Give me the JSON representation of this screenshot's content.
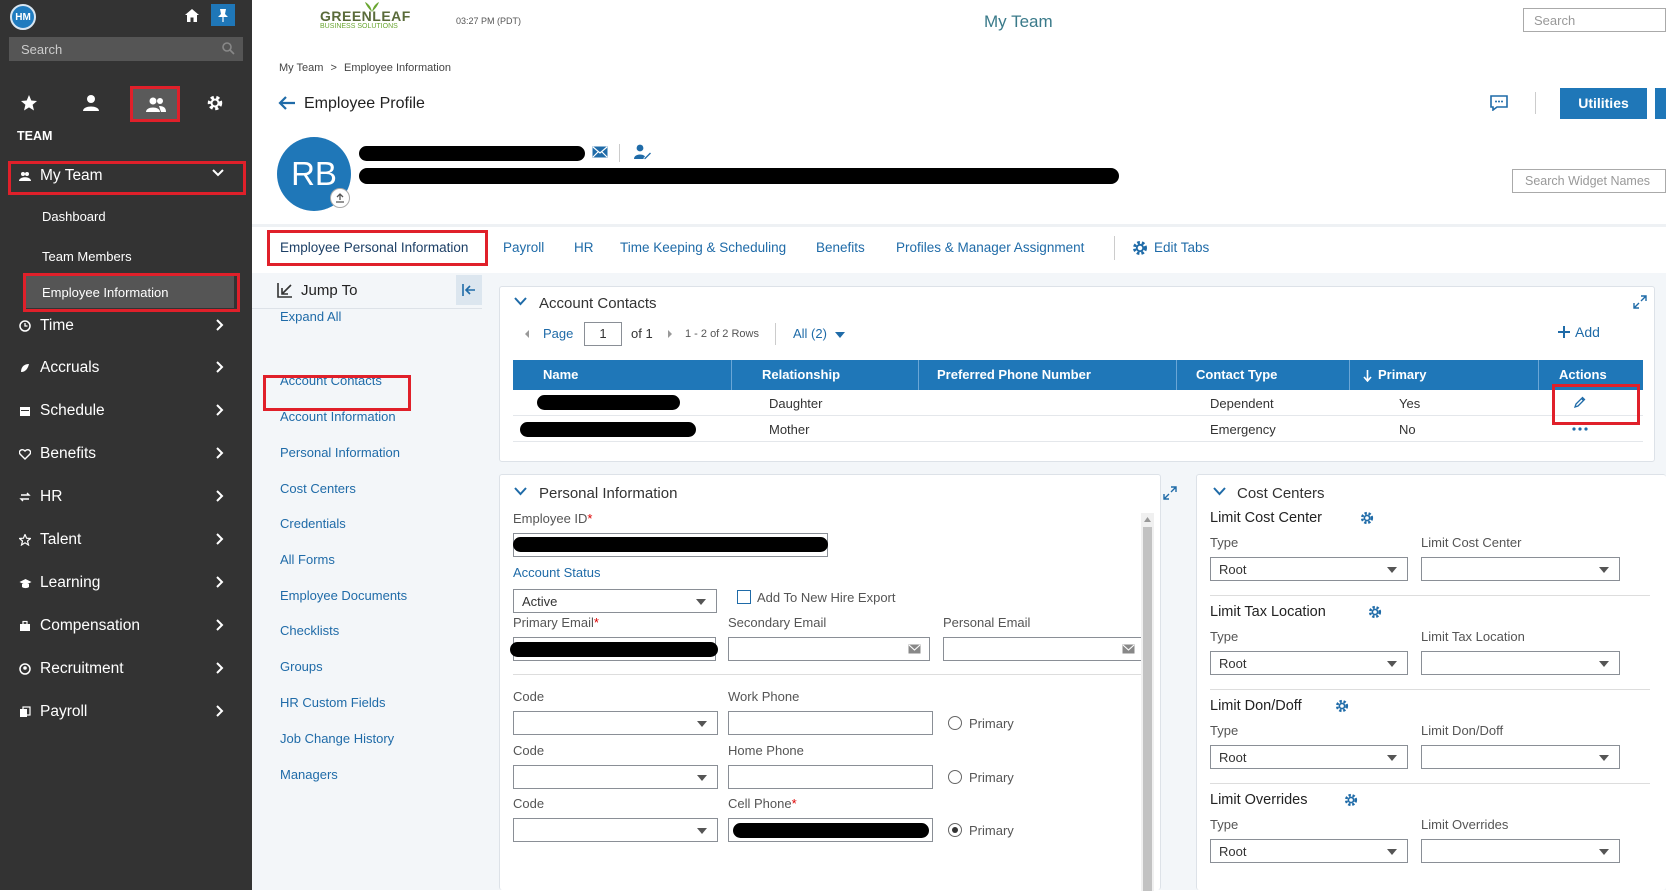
{
  "sidebar": {
    "avatar_initials": "HM",
    "search_placeholder": "Search",
    "section_title": "TEAM",
    "my_team_label": "My Team",
    "sub_items": [
      "Dashboard",
      "Team Members",
      "Employee Information"
    ],
    "nav_items": [
      "Time",
      "Accruals",
      "Schedule",
      "Benefits",
      "HR",
      "Talent",
      "Learning",
      "Compensation",
      "Recruitment",
      "Payroll"
    ]
  },
  "header": {
    "logo_top": "GREENLEAF",
    "logo_bottom": "BUSINESS SOLUTIONS",
    "time": "03:27 PM (PDT)",
    "page_title": "My Team",
    "search_placeholder": "Search"
  },
  "breadcrumb": {
    "root": "My Team",
    "sep": ">",
    "current": "Employee Information"
  },
  "profile": {
    "title": "Employee Profile",
    "initials": "RB",
    "utilities_label": "Utilities",
    "widget_search_placeholder": "Search Widget Names"
  },
  "tabs": [
    "Employee Personal Information",
    "Payroll",
    "HR",
    "Time Keeping & Scheduling",
    "Benefits",
    "Profiles & Manager Assignment"
  ],
  "edit_tabs_label": "Edit Tabs",
  "jump": {
    "title": "Jump To",
    "expand_all": "Expand All",
    "items": [
      "Account Contacts",
      "Account Information",
      "Personal Information",
      "Cost Centers",
      "Credentials",
      "All Forms",
      "Employee Documents",
      "Checklists",
      "Groups",
      "HR Custom Fields",
      "Job Change History",
      "Managers"
    ]
  },
  "account_contacts": {
    "title": "Account Contacts",
    "page_label": "Page",
    "page_value": "1",
    "of_label": "of 1",
    "rows_label": "1 - 2 of 2 Rows",
    "filter_label": "All (2)",
    "add_label": "Add",
    "columns": [
      "Name",
      "Relationship",
      "Preferred Phone Number",
      "Contact Type",
      "Primary",
      "Actions"
    ],
    "rows": [
      {
        "relationship": "Daughter",
        "phone": "",
        "type": "Dependent",
        "primary": "Yes"
      },
      {
        "relationship": "Mother",
        "phone": "",
        "type": "Emergency",
        "primary": "No"
      }
    ]
  },
  "personal_info": {
    "title": "Personal Information",
    "employee_id_label": "Employee ID",
    "account_status_label": "Account Status",
    "account_status_value": "Active",
    "new_hire_label": "Add To New Hire Export",
    "primary_email_label": "Primary Email",
    "secondary_email_label": "Secondary Email",
    "personal_email_label": "Personal Email",
    "code_label": "Code",
    "work_phone_label": "Work Phone",
    "home_phone_label": "Home Phone",
    "cell_phone_label": "Cell Phone",
    "primary_label": "Primary",
    "required_mark": "*"
  },
  "cost_centers": {
    "title": "Cost Centers",
    "type_label": "Type",
    "root_value": "Root",
    "groups": [
      {
        "title": "Limit Cost Center",
        "field": "Limit Cost Center"
      },
      {
        "title": "Limit Tax Location",
        "field": "Limit Tax Location"
      },
      {
        "title": "Limit Don/Doff",
        "field": "Limit Don/Doff"
      },
      {
        "title": "Limit Overrides",
        "field": "Limit Overrides"
      }
    ]
  },
  "colors": {
    "sidebar": "#333333",
    "accent": "#1f77b8",
    "highlight": "#e0202a",
    "link": "#1f6ba8"
  }
}
